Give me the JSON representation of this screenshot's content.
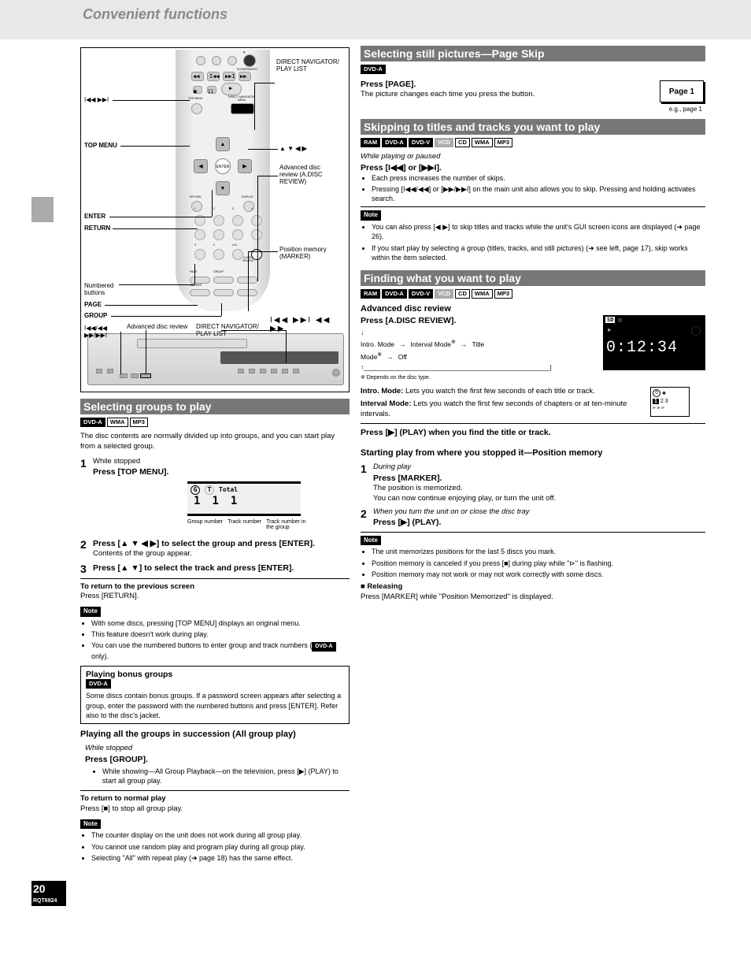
{
  "page": {
    "title": "Convenient functions",
    "number_prefix": "20",
    "rqt": "RQT6924"
  },
  "remote": {
    "return_label": "RETURN",
    "group_label": "GROUP",
    "top_menu": "TOP MENU",
    "enter": "ENTER",
    "direct_nav": "DIRECT NAVIGATOR/\nPLAY LIST",
    "adrp": "Advanced disc\nreview (A.DISC\nREVIEW)",
    "marker": "Position memory\n(MARKER)",
    "page": "PAGE",
    "numbered": "Numbered\nbuttons",
    "skip_icons": "I◀◀ ▶▶I",
    "skip_search_icons": "I◀◀ ▶▶I   ◀◀ ▶▶",
    "arrows": "▲ ▼ ◀ ▶"
  },
  "player": {
    "skip_label": "I◀◀/◀◀\n▶▶/▶▶I",
    "adrp_lbl": "Advanced disc review",
    "nav_lbl": "DIRECT NAVIGATOR/\nPLAY LIST"
  },
  "groups": {
    "title": "Selecting groups to play",
    "tags": [
      "DVD-A",
      "WMA",
      "MP3"
    ],
    "text1": "The disc contents are normally divided up into groups, and you can start play from a selected group.",
    "step1_num": "1",
    "step1": "While stopped",
    "step1b": "Press [TOP MENU].",
    "step2_num": "2",
    "step2": "Press [▲ ▼ ◀ ▶] to select the group and press [ENTER].",
    "step2b": "Contents of the group appear.",
    "step3_num": "3",
    "step3": "Press [▲ ▼] to select the track and press [ENTER].",
    "gd_g": "G",
    "gd_t": "T",
    "gd_total": "Total",
    "gd_gnum": "1",
    "gd_tnum": "1",
    "gd_total_num": "1",
    "gd_lbl_g": "Group number",
    "gd_lbl_t": "Track number",
    "gd_lbl_tg": "Track number in\nthe group",
    "return_step": "Press [RETURN].",
    "return_label": "To return to the previous screen",
    "note": "Note",
    "note1": "With some discs, pressing [TOP MENU] displays an original menu.",
    "note2": "This feature doesn't work during play.",
    "note3": "You can use the numbered buttons to enter group and track numbers (",
    "note3b": " only).",
    "bonus_title": "Playing bonus groups",
    "bonus_tag": "DVD-A",
    "bonus_text": "Some discs contain bonus groups. If a password screen appears after selecting a group, enter the password with the numbered buttons and press [ENTER]. Refer also to the disc's jacket.",
    "allgroup_title": "Playing all the groups in succession (All group play)",
    "allgroup_step": "While stopped Press [GROUP].",
    "allgroup_bul": "While showing—All Group Playback—on the television, press [▶] (PLAY) to start all group play.",
    "allgroup_return": "To return to normal play",
    "allgroup_return2": "Press [■] to stop all group play.",
    "allgroup_note1": "The counter display on the unit does not work during all group play.",
    "allgroup_note2": "You cannot use random play and program play during all group play.",
    "allgroup_note3": "Selecting \"All\" with repeat play (➜ page 18) has the same effect."
  },
  "still": {
    "title": "Selecting still pictures—Page Skip",
    "tag": "DVD-A",
    "text": "Press [PAGE].",
    "text2": "The picture changes each time you press the button.",
    "page_label": "Page 1",
    "page_hint": "e.g., page 1"
  },
  "skip": {
    "title": "Skipping to titles and tracks you want to play",
    "tags": [
      "RAM",
      "DVD-A",
      "DVD-V",
      "VCD",
      "CD",
      "WMA",
      "MP3"
    ],
    "step_label": "While playing or paused",
    "step": "Press [I◀◀] or [▶▶I].",
    "bul1": "Each press increases the number of skips.",
    "bul2": "Pressing [I◀◀/◀◀] or [▶▶/▶▶I] on the main unit also allows you to skip. Pressing and holding activates search.",
    "note_label": "Note",
    "note1": "You can also press [◀ ▶] to skip titles and tracks while the unit's GUI screen icons are displayed (➜ page 26).",
    "note2": "If you start play by selecting a group (titles, tracks, and still pictures) (➜ see left, page 17), skip works within the item selected."
  },
  "adrp": {
    "title": "Finding what you want to play",
    "tags": [
      "RAM",
      "DVD-A",
      "DVD-V",
      "VCD",
      "CD",
      "WMA",
      "MP3"
    ],
    "sub": "Advanced disc review",
    "text": "Press [A.DISC REVIEW].",
    "chain": "Intro. Mode → Interval Mode → Title Mode → Off",
    "chain_note": "※ Depends on the disc type.",
    "intro_h": "Intro. Mode:",
    "intro_t": "Lets you watch the first few seconds of each title or track.",
    "d_sd": "SD",
    "d_ind": "○",
    "d_time": "0:12:34",
    "interval_h": "Interval Mode:",
    "interval_t": "Lets you watch the first few seconds of chapters or at ten-minute intervals.",
    "text2": "Press [▶] (PLAY) when you find the title or track.",
    "marker_h": "Starting play from where you stopped it—Position memory",
    "marker_step1_n": "1",
    "marker_step1": "During play",
    "marker_step1b": "Press [MARKER].",
    "marker_step1c": "The position is memorized.",
    "marker_text": "You can now continue enjoying play, or turn the unit off.",
    "marker_step2_n": "2",
    "marker_step2": "When you turn the unit on or close the disc tray",
    "marker_step2b": "Press [▶] (PLAY).",
    "note_label": "Note",
    "note1": "The unit memorizes positions for the last 5 discs you mark.",
    "note2": "Position memory is canceled if you press [■] during play while \"⊳\" is flashing.",
    "note3": "Position memory may not work or may not work correctly with some discs.",
    "note4": "■ Releasing\nPress [MARKER] while \"Position Memorized\" is displayed."
  }
}
